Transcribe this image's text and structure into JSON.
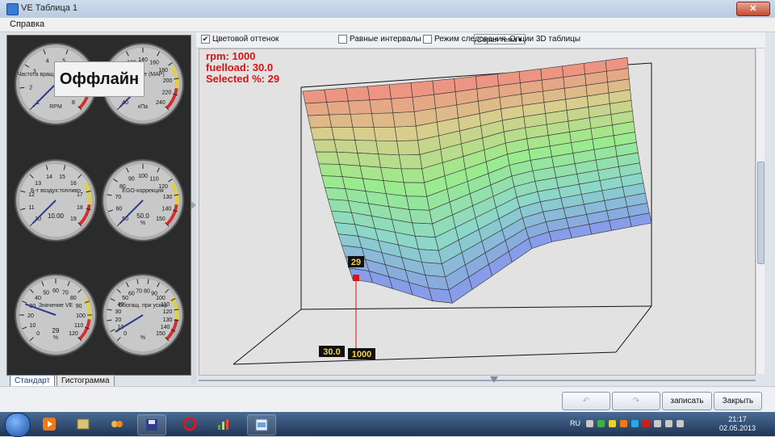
{
  "window": {
    "title": "VE Таблица 1",
    "close_label": "✕"
  },
  "menu": {
    "items": [
      "Справка"
    ]
  },
  "gauges": [
    {
      "id": "rpm",
      "label": "Частота вращения двигателя",
      "unit": "RPM",
      "ticks": [
        "1",
        "2",
        "3",
        "4",
        "5",
        "6",
        "7",
        "8"
      ],
      "value_text": ""
    },
    {
      "id": "map",
      "label": "Давление (MAP)",
      "unit": "кПа",
      "ticks": [
        "40",
        "60",
        "80",
        "100",
        "120",
        "140",
        "160",
        "180",
        "200",
        "220",
        "240"
      ],
      "value_text": ""
    },
    {
      "id": "afr",
      "label": "Б-т воздух:топливо",
      "unit": "",
      "ticks": [
        "10",
        "11",
        "12",
        "13",
        "14",
        "15",
        "16",
        "17",
        "18",
        "19"
      ],
      "value_text": "10.00"
    },
    {
      "id": "ego",
      "label": "EGO-коррекция",
      "unit": "%",
      "ticks": [
        "50",
        "60",
        "70",
        "80",
        "90",
        "100",
        "110",
        "120",
        "130",
        "140",
        "150"
      ],
      "value_text": "50.0"
    },
    {
      "id": "ve",
      "label": "Значение VE",
      "unit": "%",
      "ticks": [
        "0",
        "10",
        "20",
        "30",
        "40",
        "50",
        "60",
        "70",
        "80",
        "90",
        "100",
        "110",
        "120"
      ],
      "value_text": "29"
    },
    {
      "id": "accel",
      "label": "Обогащ. при ускор",
      "unit": "%",
      "ticks": [
        "0",
        "10",
        "20",
        "30",
        "40",
        "50",
        "60",
        "70",
        "80",
        "90",
        "100",
        "110",
        "120",
        "130",
        "140",
        "150"
      ],
      "value_text": ""
    }
  ],
  "offline_label": "Оффлайн",
  "left_tabs": [
    "Стандарт",
    "Гистограмма"
  ],
  "toolbar": {
    "color_shading": {
      "label": "Цветовой оттенок",
      "checked": true
    },
    "theme_select": "Серая тема",
    "equal_intervals": {
      "label": "Равные интервалы",
      "checked": false
    },
    "follow_mode": {
      "label": "Режим следования",
      "checked": false
    },
    "options_3d": "Опции 3D таблицы"
  },
  "readout": {
    "rpm": "rpm: 1000",
    "fuelload": "fuelload: 30.0",
    "selected": "Selected %: 29"
  },
  "surface_labels": {
    "selected_value": "29",
    "rpm_value": "1000",
    "load_value": "30.0"
  },
  "buttons": {
    "write": "записать",
    "close": "Закрыть"
  },
  "taskbar": {
    "lang": "RU",
    "time": "21:17",
    "date": "02.05.2013"
  }
}
